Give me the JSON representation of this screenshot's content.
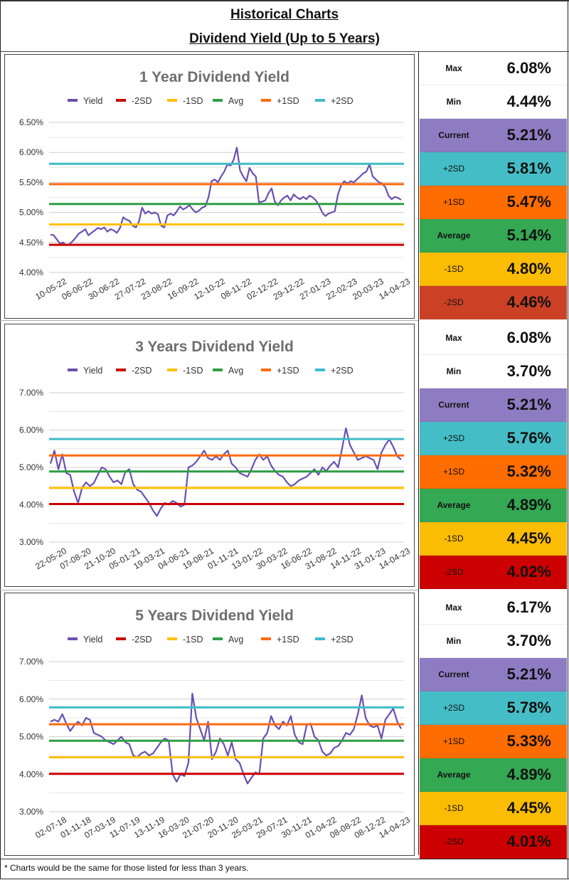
{
  "header": {
    "title": "Historical Charts",
    "subtitle": "Dividend Yield (Up to 5 Years)"
  },
  "footnote": "* Charts would be the same for those listed for less than 3 years.",
  "colors": {
    "yield": "#6A4FB0",
    "minus2sd": "#CC0000",
    "minus1sd": "#FFC000",
    "avg": "#2E9E45",
    "plus1sd": "#FF6A10",
    "plus2sd": "#3FBCC8",
    "panel_current": "#8E7CC3",
    "panel_plus2sd": "#45BDC6",
    "panel_plus1sd": "#FF6D00",
    "panel_avg": "#34A853",
    "panel_minus1sd": "#FBBC04",
    "panel_minus2sd_1y": "#CC4125",
    "panel_minus2sd": "#CC0000"
  },
  "stat_labels": {
    "max": "Max",
    "min": "Min",
    "current": "Current",
    "plus2sd": "+2SD",
    "plus1sd": "+1SD",
    "avg": "Average",
    "minus1sd": "-1SD",
    "minus2sd": "-2SD"
  },
  "panels": [
    {
      "max": "6.08%",
      "min": "4.44%",
      "current": "5.21%",
      "plus2sd": "5.81%",
      "plus1sd": "5.47%",
      "avg": "5.14%",
      "minus1sd": "4.80%",
      "minus2sd": "4.46%"
    },
    {
      "max": "6.08%",
      "min": "3.70%",
      "current": "5.21%",
      "plus2sd": "5.76%",
      "plus1sd": "5.32%",
      "avg": "4.89%",
      "minus1sd": "4.45%",
      "minus2sd": "4.02%"
    },
    {
      "max": "6.17%",
      "min": "3.70%",
      "current": "5.21%",
      "plus2sd": "5.78%",
      "plus1sd": "5.33%",
      "avg": "4.89%",
      "minus1sd": "4.45%",
      "minus2sd": "4.01%"
    }
  ],
  "chart_data": [
    {
      "type": "line",
      "title": "1 Year Dividend Yield",
      "legend": [
        "Yield",
        "-2SD",
        "-1SD",
        "Avg",
        "+1SD",
        "+2SD"
      ],
      "legend_position": "top",
      "grid": true,
      "ylim": [
        4.0,
        6.5
      ],
      "yticks": [
        4.0,
        4.5,
        5.0,
        5.5,
        6.0,
        6.5
      ],
      "ytick_labels": [
        "4.00%",
        "4.50%",
        "5.00%",
        "5.50%",
        "6.00%",
        "6.50%"
      ],
      "xtick_labels": [
        "10-05-22",
        "06-06-22",
        "30-06-22",
        "27-07-22",
        "23-08-22",
        "16-09-22",
        "12-10-22",
        "08-11-22",
        "02-12-22",
        "29-12-22",
        "27-01-23",
        "22-02-23",
        "20-03-23",
        "14-04-23"
      ],
      "bands": {
        "minus2sd": 4.46,
        "minus1sd": 4.8,
        "avg": 5.14,
        "plus1sd": 5.47,
        "plus2sd": 5.81
      },
      "series": [
        {
          "name": "Yield",
          "values": [
            4.63,
            4.62,
            4.55,
            4.48,
            4.5,
            4.45,
            4.47,
            4.52,
            4.58,
            4.65,
            4.68,
            4.72,
            4.62,
            4.66,
            4.7,
            4.74,
            4.72,
            4.75,
            4.68,
            4.72,
            4.7,
            4.66,
            4.74,
            4.92,
            4.88,
            4.86,
            4.78,
            4.75,
            4.85,
            5.08,
            4.98,
            5.02,
            4.98,
            5.0,
            4.97,
            4.78,
            4.75,
            4.95,
            4.98,
            4.95,
            5.02,
            5.1,
            5.05,
            5.08,
            5.12,
            5.05,
            5.0,
            5.03,
            5.08,
            5.1,
            5.25,
            5.52,
            5.55,
            5.5,
            5.6,
            5.68,
            5.8,
            5.78,
            5.88,
            6.08,
            5.7,
            5.6,
            5.52,
            5.74,
            5.65,
            5.6,
            5.17,
            5.18,
            5.2,
            5.32,
            5.4,
            5.18,
            5.12,
            5.2,
            5.25,
            5.28,
            5.2,
            5.3,
            5.25,
            5.22,
            5.26,
            5.22,
            5.28,
            5.25,
            5.2,
            5.12,
            5.0,
            4.94,
            4.98,
            5.0,
            5.02,
            5.3,
            5.45,
            5.52,
            5.48,
            5.52,
            5.5,
            5.55,
            5.6,
            5.65,
            5.68,
            5.8,
            5.6,
            5.55,
            5.5,
            5.48,
            5.42,
            5.28,
            5.22,
            5.26,
            5.24,
            5.21
          ]
        }
      ]
    },
    {
      "type": "line",
      "title": "3 Years Dividend Yield",
      "legend": [
        "Yield",
        "-2SD",
        "-1SD",
        "Avg",
        "+1SD",
        "+2SD"
      ],
      "legend_position": "top",
      "grid": true,
      "ylim": [
        3.0,
        7.0
      ],
      "yticks": [
        3.0,
        4.0,
        5.0,
        6.0,
        7.0
      ],
      "ytick_labels": [
        "3.00%",
        "4.00%",
        "5.00%",
        "6.00%",
        "7.00%"
      ],
      "xtick_labels": [
        "22-05-20",
        "07-08-20",
        "21-10-20",
        "05-01-21",
        "19-03-21",
        "04-06-21",
        "19-08-21",
        "01-11-21",
        "13-01-22",
        "30-03-22",
        "16-06-22",
        "31-08-22",
        "14-11-22",
        "31-01-23",
        "14-04-23"
      ],
      "bands": {
        "minus2sd": 4.02,
        "minus1sd": 4.45,
        "avg": 4.89,
        "plus1sd": 5.32,
        "plus2sd": 5.76
      },
      "series": [
        {
          "name": "Yield",
          "values": [
            5.1,
            5.45,
            4.95,
            5.35,
            4.85,
            4.8,
            4.35,
            4.05,
            4.45,
            4.6,
            4.5,
            4.58,
            4.8,
            5.0,
            4.95,
            4.75,
            4.6,
            4.65,
            4.55,
            4.88,
            4.95,
            4.55,
            4.4,
            4.35,
            4.2,
            4.05,
            3.85,
            3.7,
            3.9,
            4.05,
            4.0,
            4.1,
            4.05,
            3.95,
            4.0,
            5.0,
            5.05,
            5.15,
            5.3,
            5.45,
            5.25,
            5.2,
            5.3,
            5.2,
            5.35,
            5.45,
            5.1,
            5.0,
            4.85,
            4.8,
            4.75,
            4.95,
            5.2,
            5.35,
            5.2,
            5.3,
            5.05,
            4.9,
            4.8,
            4.75,
            4.6,
            4.5,
            4.55,
            4.65,
            4.7,
            4.75,
            4.85,
            4.95,
            4.8,
            5.0,
            4.9,
            5.05,
            5.15,
            5.0,
            5.5,
            6.05,
            5.6,
            5.4,
            5.2,
            5.25,
            5.3,
            5.25,
            5.2,
            4.95,
            5.4,
            5.6,
            5.75,
            5.55,
            5.3,
            5.21
          ]
        }
      ]
    },
    {
      "type": "line",
      "title": "5 Years Dividend Yield",
      "legend": [
        "Yield",
        "-2SD",
        "-1SD",
        "Avg",
        "+1SD",
        "+2SD"
      ],
      "legend_position": "top",
      "grid": true,
      "ylim": [
        3.0,
        7.0
      ],
      "yticks": [
        3.0,
        4.0,
        5.0,
        6.0,
        7.0
      ],
      "ytick_labels": [
        "3.00%",
        "4.00%",
        "5.00%",
        "6.00%",
        "7.00%"
      ],
      "xtick_labels": [
        "02-07-18",
        "01-11-18",
        "07-03-19",
        "11-07-19",
        "13-11-19",
        "16-03-20",
        "21-07-20",
        "20-11-20",
        "25-03-21",
        "29-07-21",
        "30-11-21",
        "01-04-22",
        "08-08-22",
        "08-12-22",
        "14-04-23"
      ],
      "bands": {
        "minus2sd": 4.01,
        "minus1sd": 4.45,
        "avg": 4.89,
        "plus1sd": 5.33,
        "plus2sd": 5.78
      },
      "series": [
        {
          "name": "Yield",
          "values": [
            5.4,
            5.45,
            5.4,
            5.6,
            5.35,
            5.15,
            5.3,
            5.4,
            5.3,
            5.5,
            5.45,
            5.1,
            5.05,
            5.0,
            4.9,
            4.85,
            4.8,
            4.9,
            5.0,
            4.85,
            4.8,
            4.5,
            4.45,
            4.55,
            4.6,
            4.5,
            4.55,
            4.7,
            4.85,
            4.95,
            4.9,
            4.0,
            3.8,
            4.0,
            3.95,
            4.3,
            6.15,
            5.5,
            5.2,
            4.9,
            5.4,
            4.4,
            4.6,
            4.95,
            4.8,
            4.5,
            4.85,
            4.4,
            4.3,
            4.0,
            3.75,
            3.9,
            4.05,
            4.0,
            4.95,
            5.1,
            5.55,
            5.3,
            5.2,
            5.4,
            5.3,
            5.55,
            5.05,
            4.85,
            4.8,
            5.3,
            5.35,
            5.0,
            4.9,
            4.6,
            4.5,
            4.55,
            4.7,
            4.75,
            4.9,
            5.1,
            5.05,
            5.2,
            5.6,
            6.1,
            5.5,
            5.3,
            5.25,
            5.3,
            4.95,
            5.45,
            5.6,
            5.75,
            5.4,
            5.21
          ]
        }
      ]
    }
  ]
}
